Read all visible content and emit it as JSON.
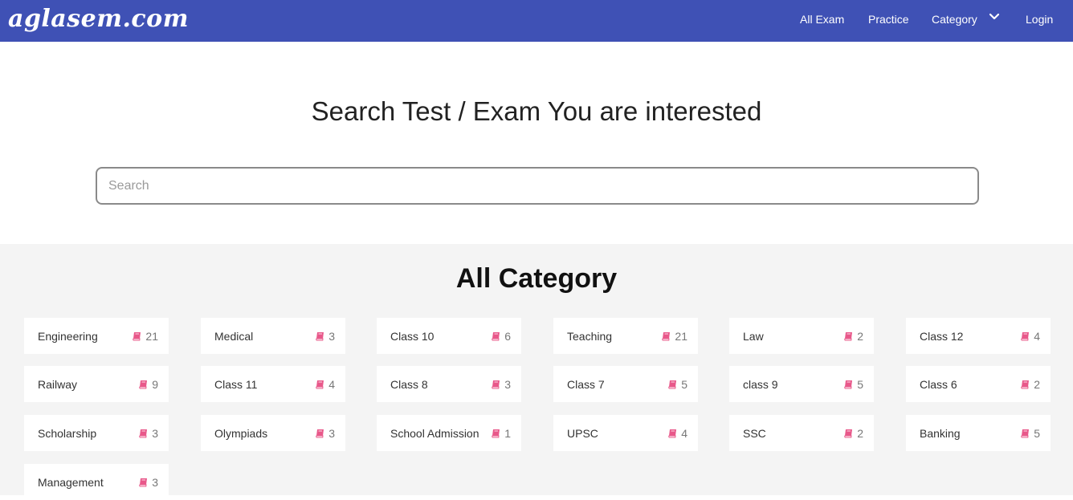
{
  "brand": {
    "logo": "aglasem.com"
  },
  "nav": {
    "items": [
      "All Exam",
      "Practice",
      "Category",
      "Login"
    ],
    "category_icon": "chevron-down-icon"
  },
  "hero": {
    "title": "Search Test / Exam You are interested",
    "search": {
      "placeholder": "Search",
      "value": ""
    }
  },
  "categories": {
    "heading": "All Category",
    "count_icon": "book-icon",
    "accent_color": "#e8588a",
    "items": [
      {
        "name": "Engineering",
        "count": "21"
      },
      {
        "name": "Medical",
        "count": "3"
      },
      {
        "name": "Class 10",
        "count": "6"
      },
      {
        "name": "Teaching",
        "count": "21"
      },
      {
        "name": "Law",
        "count": "2"
      },
      {
        "name": "Class 12",
        "count": "4"
      },
      {
        "name": "Railway",
        "count": "9"
      },
      {
        "name": "Class 11",
        "count": "4"
      },
      {
        "name": "Class 8",
        "count": "3"
      },
      {
        "name": "Class 7",
        "count": "5"
      },
      {
        "name": "class 9",
        "count": "5"
      },
      {
        "name": "Class 6",
        "count": "2"
      },
      {
        "name": "Scholarship",
        "count": "3"
      },
      {
        "name": "Olympiads",
        "count": "3"
      },
      {
        "name": "School Admission",
        "count": "1"
      },
      {
        "name": "UPSC",
        "count": "4"
      },
      {
        "name": "SSC",
        "count": "2"
      },
      {
        "name": "Banking",
        "count": "5"
      },
      {
        "name": "Management",
        "count": "3"
      }
    ]
  },
  "colors": {
    "navbar": "#3f51b5",
    "section_bg": "#f4f4f4"
  }
}
